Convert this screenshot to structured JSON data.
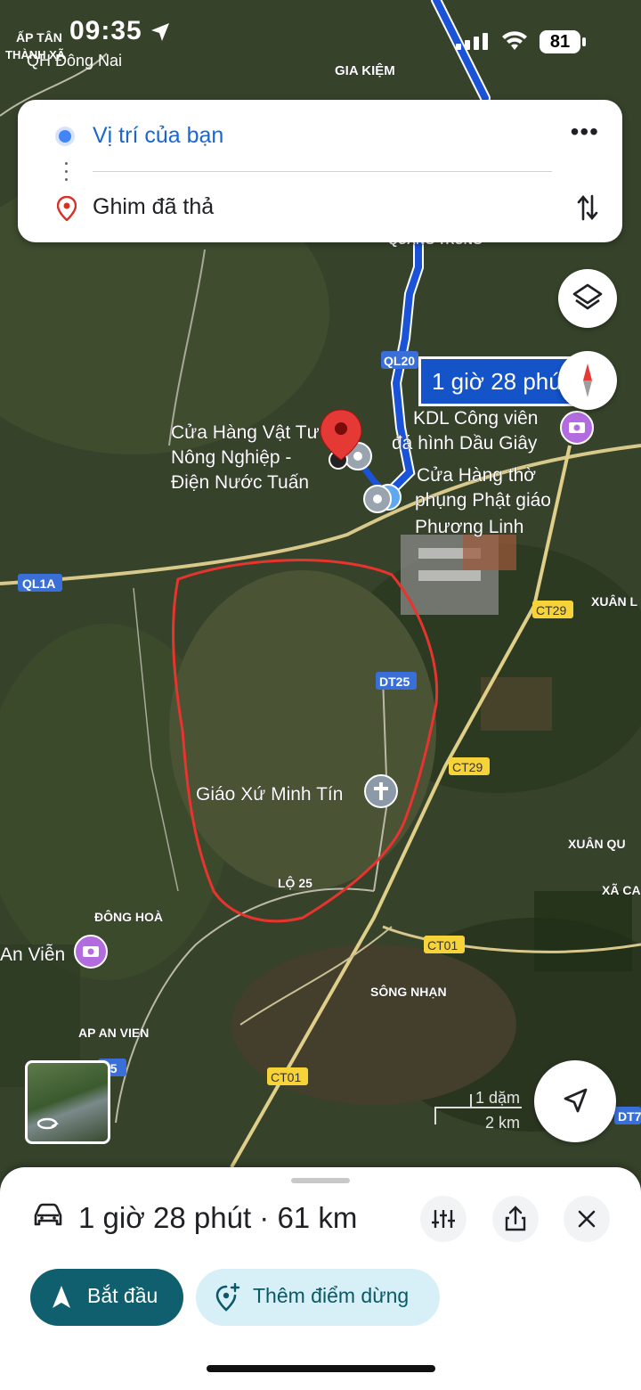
{
  "status_bar": {
    "time": "09:35",
    "location_top": "ẤP TÂN",
    "location_bottom": "THÀNH XÃ",
    "sub_location": "QH Đông Nai",
    "battery": "81"
  },
  "route_card": {
    "origin": "Vị trí của bạn",
    "destination": "Ghim đã thả",
    "more_label": "•••"
  },
  "map": {
    "route_chip": "1 giờ 28 phút",
    "road_badges": {
      "ql20": "QL20",
      "ql1a": "QL1A",
      "dt25": "DT25",
      "ct29_a": "CT29",
      "ct29_b": "CT29",
      "ct01_a": "CT01",
      "ct01_b": "CT01",
      "r25": "25",
      "dt7": "DT7"
    },
    "place_labels": {
      "gia_kiem": "GIA KIỆM",
      "quang_trung": "QUANG TRUNG",
      "shop1_l1": "Cửa Hàng Vật Tư",
      "shop1_l2": "Nông Nghiệp -",
      "shop1_l3": "Điện Nước Tuấn",
      "kdl_l1": "KDL Công viên",
      "kdl_l2": "đá hình Dầu Giây",
      "shop2_l1": "Cửa Hàng thờ",
      "shop2_l2": "phụng Phật giáo",
      "shop2_l3": "Phương Linh",
      "xuan_l": "XUÂN L",
      "giao_xu": "Giáo Xứ Minh Tín",
      "lo25": "LỘ 25",
      "xuan_qu": "XUÂN QU",
      "xa_ca": "XÃ CA",
      "dong_hoa": "ĐÔNG HOÀ",
      "an_vien": "An Viễn",
      "song_nhan": "SÔNG NHẠN",
      "ap_an_vien": "AP AN VIEN"
    },
    "scale": {
      "miles": "1 dặm",
      "km": "2 km"
    },
    "icons": [
      "layers-icon",
      "compass-icon",
      "locate-arrow-icon",
      "pin-icon",
      "camera-icon",
      "church-icon"
    ]
  },
  "bottom_sheet": {
    "summary": "1 giờ 28 phút · 61 km",
    "start_label": "Bắt đầu",
    "add_stop_label": "Thêm điểm dừng"
  },
  "colors": {
    "route": "#1a53d8",
    "start_button": "#0f5f6e",
    "add_stop_bg": "#d7f0f8",
    "pin": "#e53935",
    "circled_area": "#e8332f"
  }
}
